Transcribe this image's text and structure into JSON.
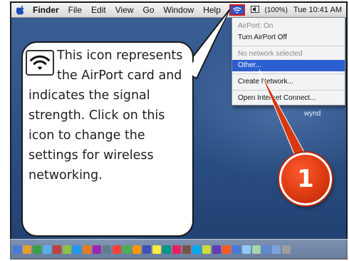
{
  "menubar": {
    "apple_icon": "apple-logo-icon",
    "items": [
      "Finder",
      "File",
      "Edit",
      "View",
      "Go",
      "Window",
      "Help"
    ],
    "battery": "(100%)",
    "clock": "Tue 10:41 AM"
  },
  "airport_menu": {
    "status": "AirPort: On",
    "toggle": "Turn AirPort Off",
    "network_status": "No network selected",
    "other": "Other...",
    "create_network": "Create Network...",
    "internet_connect": "Open Internet Connect..."
  },
  "desktop": {
    "disk_label": "wynd"
  },
  "callout": {
    "icon": "wifi-signal-icon",
    "text": "This icon represents the AirPort card and indicates the signal strength. Click on this icon to change the settings for wireless networking."
  },
  "badge": {
    "number": "1"
  },
  "colors": {
    "highlight_box": "#d31b1b",
    "badge": "#d8380f",
    "menu_highlight": "#2c5fcf"
  }
}
